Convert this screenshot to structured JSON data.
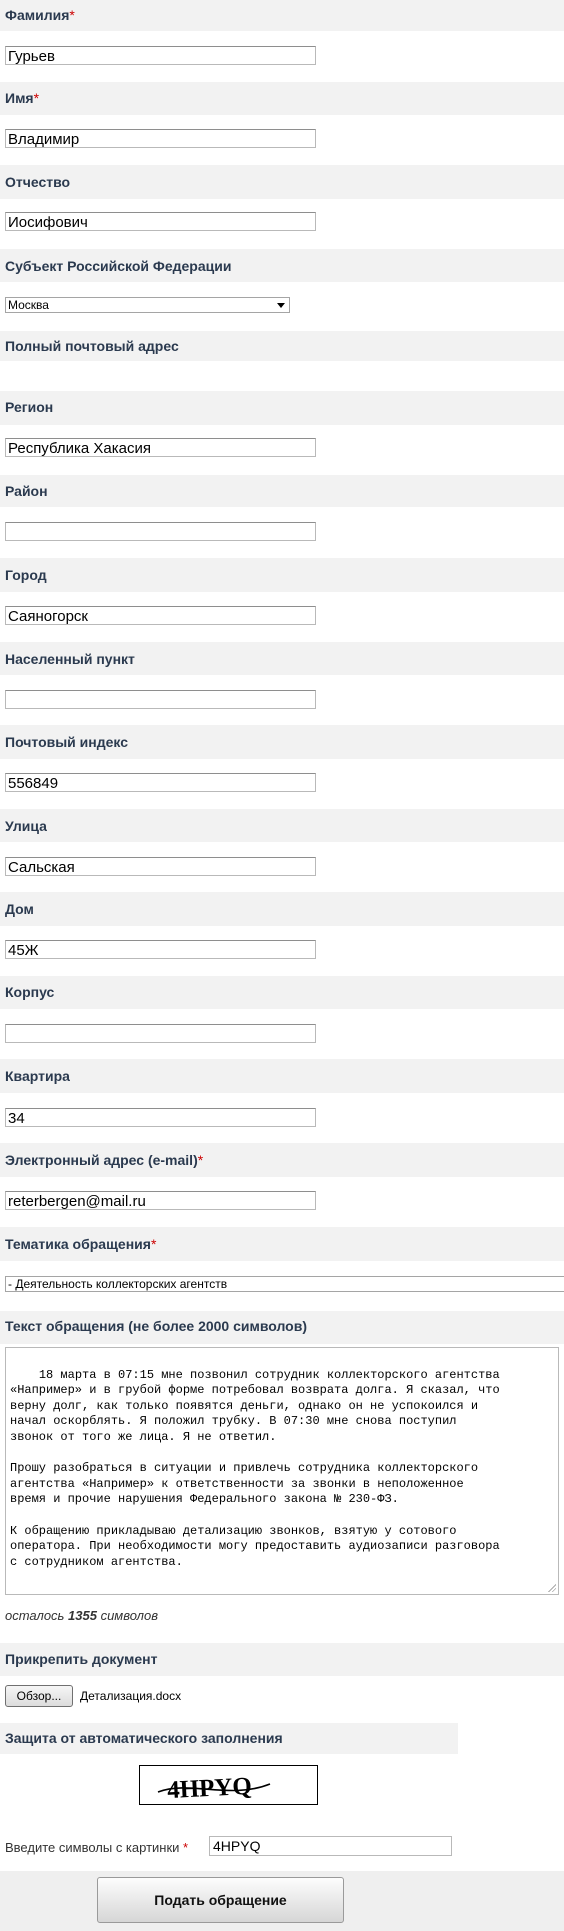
{
  "required_mark": "*",
  "fields": {
    "last_name": {
      "label": "Фамилия",
      "value": "Гурьев"
    },
    "first_name": {
      "label": "Имя",
      "value": "Владимир"
    },
    "patronymic": {
      "label": "Отчество",
      "value": "Иосифович"
    },
    "subject": {
      "label": "Субъект Российской Федерации",
      "value": "Москва"
    },
    "postal_address_heading": {
      "label": "Полный почтовый адрес"
    },
    "region": {
      "label": "Регион",
      "value": "Республика Хакасия"
    },
    "district": {
      "label": "Район",
      "value": ""
    },
    "city": {
      "label": "Город",
      "value": "Саяногорск"
    },
    "settlement": {
      "label": "Населенный пункт",
      "value": ""
    },
    "postcode": {
      "label": "Почтовый индекс",
      "value": "556849"
    },
    "street": {
      "label": "Улица",
      "value": "Сальская"
    },
    "house": {
      "label": "Дом",
      "value": "45Ж"
    },
    "building": {
      "label": "Корпус",
      "value": ""
    },
    "apartment": {
      "label": "Квартира",
      "value": "34"
    },
    "email": {
      "label": "Электронный адрес (e-mail)",
      "value": "reterbergen@mail.ru"
    },
    "topic": {
      "label": "Тематика обращения",
      "value": "- Деятельность коллекторских агентств"
    },
    "message": {
      "label": "Текст обращения (не более 2000 символов)",
      "value": "18 марта в 07:15 мне позвонил сотрудник коллекторского агентства\n«Например» и в грубой форме потребовал возврата долга. Я сказал, что\nверну долг, как только появятся деньги, однако он не успокоился и\nначал оскорблять. Я положил трубку. В 07:30 мне снова поступил\nзвонок от того же лица. Я не ответил.\n\nПрошу разобраться в ситуации и привлечь сотрудника коллекторского\nагентства «Например» к ответственности за звонки в неположенное\nвремя и прочие нарушения Федерального закона № 230-ФЗ.\n\nК обращению прикладываю детализацию звонков, взятую у сотового\nоператора. При необходимости могу предоставить аудиозаписи разговора\nс сотрудником агентства."
    }
  },
  "counter": {
    "prefix": "осталось",
    "remaining": "1355",
    "suffix": "символов"
  },
  "attachment": {
    "label": "Прикрепить документ",
    "browse_label": "Обзор...",
    "file_name": "Детализация.docx"
  },
  "captcha": {
    "heading": "Защита от автоматического заполнения",
    "image_text": "4HPYQ",
    "prompt": "Введите символы с картинки",
    "value": "4HPYQ"
  },
  "submit_label": "Подать обращение"
}
